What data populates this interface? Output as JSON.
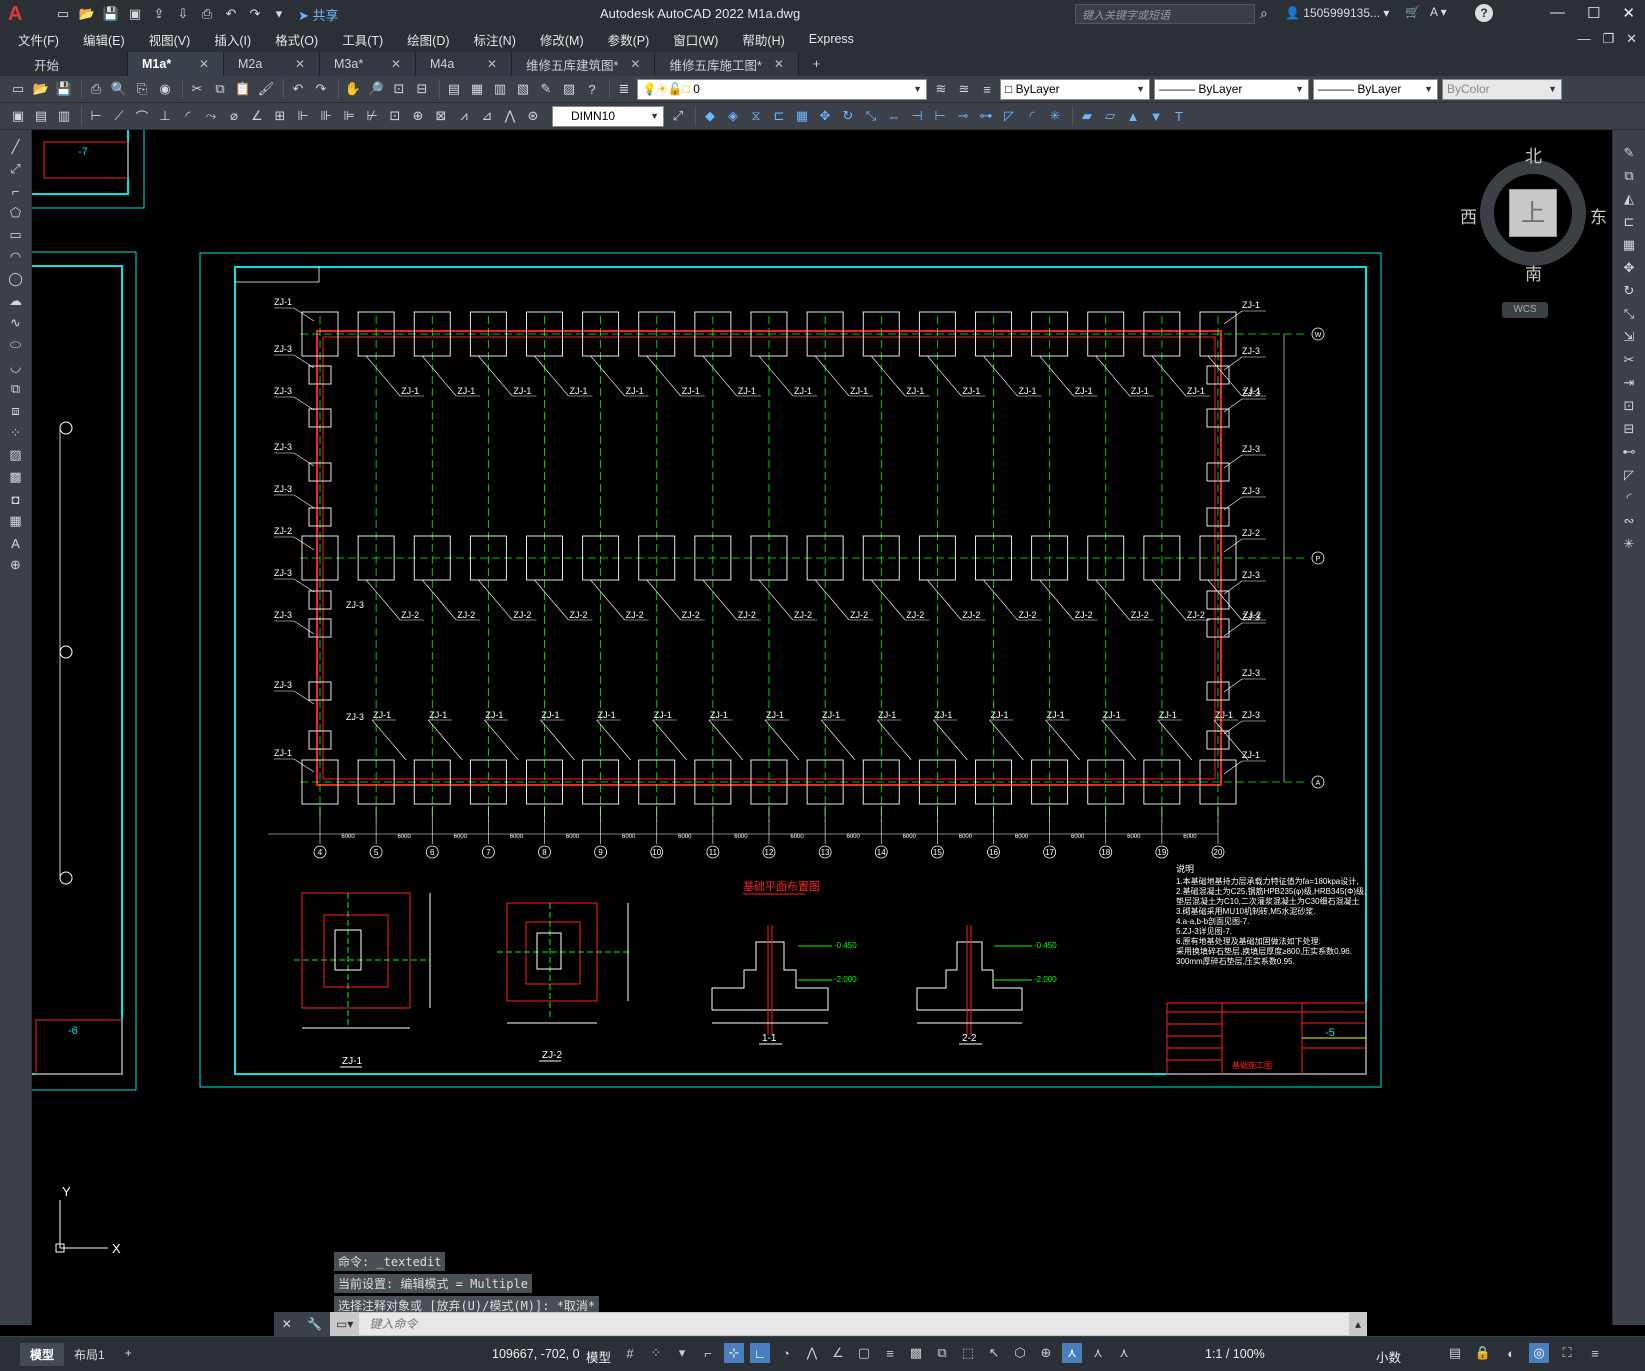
{
  "app": {
    "logo": "A",
    "title": "Autodesk AutoCAD 2022    M1a.dwg",
    "search_placeholder": "键入关键字或短语",
    "user": "1505999135...",
    "share": "共享",
    "help": "?"
  },
  "menu": [
    "文件(F)",
    "编辑(E)",
    "视图(V)",
    "插入(I)",
    "格式(O)",
    "工具(T)",
    "绘图(D)",
    "标注(N)",
    "修改(M)",
    "参数(P)",
    "窗口(W)",
    "帮助(H)",
    "Express"
  ],
  "tabs": [
    {
      "label": "开始",
      "closable": false
    },
    {
      "label": "M1a*",
      "closable": true,
      "active": true
    },
    {
      "label": "M2a",
      "closable": true
    },
    {
      "label": "M3a*",
      "closable": true
    },
    {
      "label": "M4a",
      "closable": true
    },
    {
      "label": "维修五库建筑图*",
      "closable": true
    },
    {
      "label": "维修五库施工图*",
      "closable": true
    }
  ],
  "toolbar": {
    "layer": "0",
    "color": "ByLayer",
    "linetype": "ByLayer",
    "lineweight": "ByLayer",
    "plotstyle": "ByColor",
    "dimstyle": "DIMN10"
  },
  "viewcube": {
    "north": "北",
    "south": "南",
    "west": "西",
    "east": "东",
    "face": "上",
    "wcs": "WCS"
  },
  "drawing": {
    "colors": {
      "frame": "#00e5e5",
      "red": "#ff2020",
      "green": "#00ff00",
      "white": "#ffffff",
      "yellow": "#ffff00"
    },
    "top_labels_right": [
      "ZJ-1",
      "ZJ-3",
      "ZJ-3",
      "ZJ-3",
      "ZJ-3",
      "ZJ-2",
      "ZJ-3",
      "ZJ-3",
      "ZJ-3",
      "ZJ-3",
      "ZJ-1"
    ],
    "row_labels_zj1": "ZJ-1",
    "row_labels_zj2": "ZJ-2",
    "zj3": "ZJ-3",
    "axis_numbers": [
      "4",
      "5",
      "6",
      "7",
      "8",
      "9",
      "10",
      "11",
      "12",
      "13",
      "14",
      "15",
      "16",
      "17",
      "18",
      "19",
      "20"
    ],
    "axis_letters": [
      "W",
      "P",
      "A"
    ],
    "spacing": "6000",
    "plan_title": "基础平面布置图",
    "detail_titles": [
      "ZJ-1",
      "ZJ-2",
      "1-1",
      "2-2"
    ],
    "notes_title": "说明",
    "notes": [
      "1.本基础地基持力层承载力特征值为fa=180kpa设计,",
      "2.基础混凝土为C25,钢筋HPB235(φ)级,HRB345(Φ)级,",
      "  垫层混凝土为C10,二次灌浆混凝土为C30细石混凝土",
      "3.砌基础采用MU10机制砖,M5水泥砂浆.",
      "4.a-a,b-b剖面见图-7.",
      "5.ZJ-3详见图-7.",
      "6.原有地基处理及基础加固做法如下处理:",
      "  采用换填碎石垫层,换填层厚度≥800,压实系数0.96.",
      "  300mm厚碎石垫层,压实系数0.95."
    ],
    "sheet_no_right": "-5",
    "sheet_no_left_bottom": "-6",
    "sheet_no_left_top": "-7",
    "title_block_caption": "基础施工图",
    "elev_labels": [
      "-0.450",
      "-2.000"
    ]
  },
  "command": {
    "history": [
      "命令: _textedit",
      "当前设置: 编辑模式 = Multiple",
      "选择注释对象或 [放弃(U)/模式(M)]: *取消*"
    ],
    "placeholder": "键入命令"
  },
  "status": {
    "layouts": [
      "模型",
      "布局1"
    ],
    "add_layout": "+",
    "coords": "109667, -702, 0",
    "space": "模型",
    "scale": "1:1 / 100%",
    "units": "小数"
  },
  "ucs": {
    "y": "Y",
    "x": "X"
  }
}
